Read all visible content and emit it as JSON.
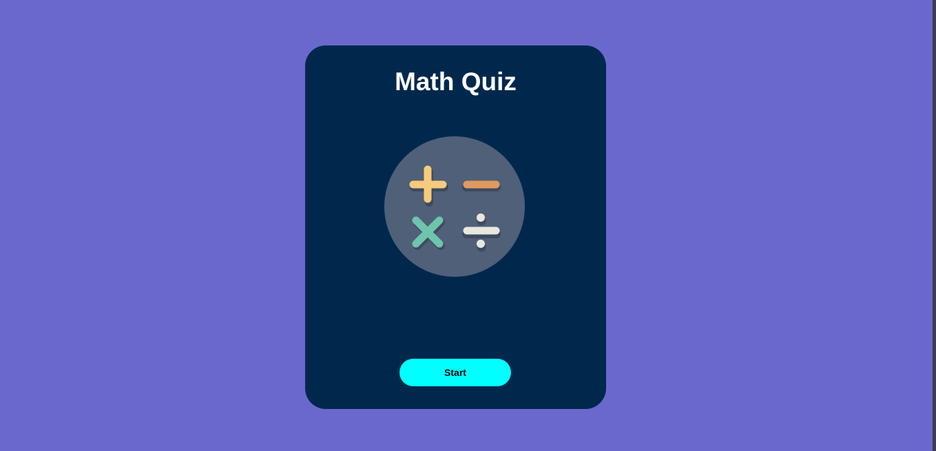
{
  "quiz": {
    "title": "Math Quiz",
    "illustration_icon": "math-operators-icon",
    "start_label": "Start"
  },
  "colors": {
    "page_background": "#6b68cd",
    "card_background": "#00284d",
    "circle_background": "#506078",
    "plus_color": "#f7cb7c",
    "minus_color": "#e09a60",
    "times_color": "#6ec4ad",
    "divide_color": "#e8e8e0",
    "button_background": "#00ffff"
  }
}
